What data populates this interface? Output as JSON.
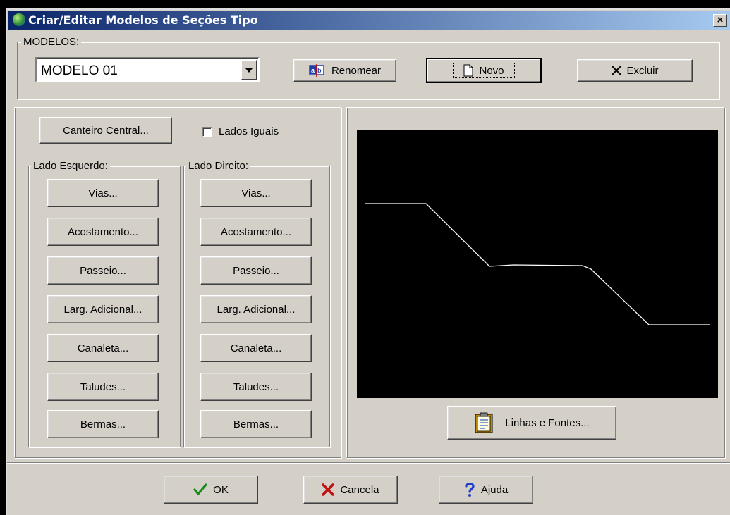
{
  "window": {
    "title": "Criar/Editar Modelos de Seções Tipo",
    "close_label": "×"
  },
  "modelos": {
    "label": "MODELOS:",
    "selected": "MODELO 01",
    "rename_label": "Renomear",
    "new_label": "Novo",
    "delete_label": "Excluir"
  },
  "options": {
    "canteiro_label": "Canteiro Central...",
    "lados_iguais_label": "Lados Iguais",
    "lados_iguais_checked": false
  },
  "left_side": {
    "label": "Lado Esquerdo:",
    "buttons": [
      "Vias...",
      "Acostamento...",
      "Passeio...",
      "Larg. Adicional...",
      "Canaleta...",
      "Taludes...",
      "Bermas..."
    ]
  },
  "right_side": {
    "label": "Lado Direito:",
    "buttons": [
      "Vias...",
      "Acostamento...",
      "Passeio...",
      "Larg. Adicional...",
      "Canaleta...",
      "Taludes...",
      "Bermas..."
    ]
  },
  "preview": {
    "background": "#000000",
    "line_color": "#ffffff",
    "linhas_fontes_label": "Linhas e Fontes..."
  },
  "footer": {
    "ok_label": "OK",
    "cancel_label": "Cancela",
    "help_label": "Ajuda"
  },
  "colors": {
    "title_start": "#0a246a",
    "title_end": "#a6caf0",
    "face": "#d4d0c8"
  }
}
